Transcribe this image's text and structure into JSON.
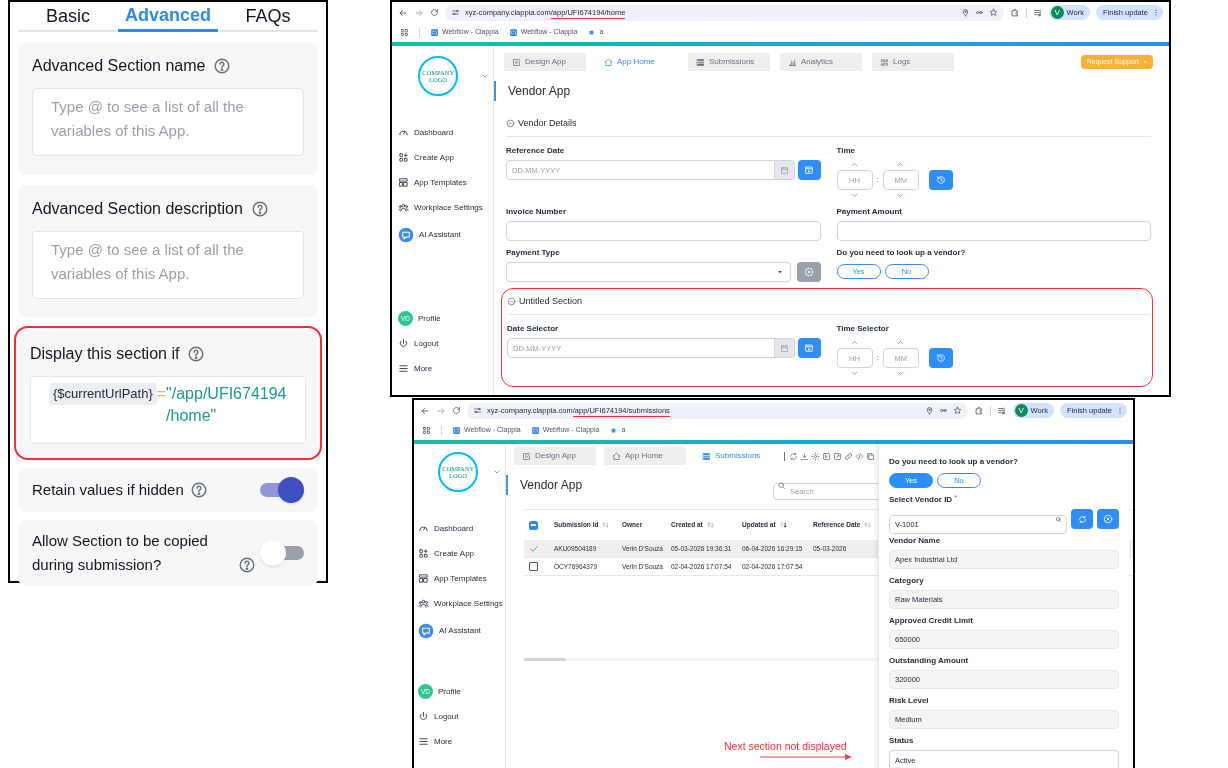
{
  "settings_panel": {
    "tabs": [
      {
        "label": "Basic",
        "selected": false
      },
      {
        "label": "Advanced",
        "selected": true
      },
      {
        "label": "FAQs",
        "selected": false
      }
    ],
    "text_fields": [
      {
        "label": "Advanced Section name",
        "placeholder": "Type @ to see a list of all the variables of this App."
      },
      {
        "label": "Advanced Section description",
        "placeholder": "Type @ to see a list of all the variables of this App."
      }
    ],
    "condition": {
      "label": "Display this section if",
      "variable": "{$currentUrlPath}",
      "operator": "=",
      "value": "\"/app/UFI674194/home\"",
      "highlighted": true
    },
    "toggles": [
      {
        "label": "Retain values if hidden",
        "on": true
      },
      {
        "label": "Allow Section to be copied during submission?",
        "on": false
      }
    ]
  },
  "home_window": {
    "browser": {
      "url_host": "xyz-company.clappia.com",
      "url_path": "/app/UFI674194/home",
      "path_underlined": true,
      "bookmarks": [
        "Webflow - Clappia",
        "Webflow - Clappia",
        "a"
      ],
      "profile_initial": "V",
      "profile_label": "Work",
      "update_label": "Finish update"
    },
    "sidebar": {
      "logo_text": "COMPANY LOGO",
      "items": [
        {
          "label": "Dashboard"
        },
        {
          "label": "Create App"
        },
        {
          "label": "App Templates"
        },
        {
          "label": "Workplace Settings"
        },
        {
          "label": "AI Assistant"
        }
      ],
      "bottom_items": [
        {
          "label": "Profile",
          "initials": "VD"
        },
        {
          "label": "Logout"
        },
        {
          "label": "More"
        }
      ]
    },
    "tabs": [
      {
        "label": "Design App",
        "selected": false
      },
      {
        "label": "App Home",
        "selected": true
      },
      {
        "label": "Submissions",
        "selected": false
      },
      {
        "label": "Analytics",
        "selected": false
      },
      {
        "label": "Logs",
        "selected": false
      }
    ],
    "support_button": "Request Support",
    "title": "Vendor App",
    "sections": [
      {
        "title": "Vendor Details",
        "highlighted": false,
        "fields": [
          {
            "kind": "date",
            "label": "Reference Date",
            "placeholder": "DD-MM-YYYY"
          },
          {
            "kind": "time",
            "label": "Time",
            "hour_placeholder": "HH",
            "minute_placeholder": "MM",
            "separator": ":"
          },
          {
            "kind": "text",
            "label": "Invoice Number"
          },
          {
            "kind": "text",
            "label": "Payment Amount"
          },
          {
            "kind": "dropdown",
            "label": "Payment Type"
          },
          {
            "kind": "choice",
            "label": "Do you need to look up a vendor?",
            "options": [
              {
                "label": "Yes",
                "selected": false
              },
              {
                "label": "No",
                "selected": false
              }
            ]
          }
        ]
      },
      {
        "title": "Untitled Section",
        "highlighted": true,
        "fields": [
          {
            "kind": "date",
            "label": "Date Selector",
            "placeholder": "DD-MM-YYYY"
          },
          {
            "kind": "time",
            "label": "Time Selector",
            "hour_placeholder": "HH",
            "minute_placeholder": "MM",
            "separator": ":"
          }
        ]
      }
    ]
  },
  "submissions_window": {
    "browser": {
      "url_host": "xyz-company.clappia.com",
      "url_path": "/app/UFI674194/submissions",
      "path_underlined": true,
      "bookmarks": [
        "Webflow - Clappia",
        "Webflow - Clappia",
        "a"
      ],
      "profile_initial": "V",
      "profile_label": "Work",
      "update_label": "Finish update"
    },
    "sidebar": {
      "logo_text": "COMPANY LOGO",
      "items": [
        {
          "label": "Dashboard"
        },
        {
          "label": "Create App"
        },
        {
          "label": "App Templates"
        },
        {
          "label": "Workplace Settings"
        },
        {
          "label": "AI Assistant"
        }
      ],
      "bottom_items": [
        {
          "label": "Profile",
          "initials": "VD"
        },
        {
          "label": "Logout"
        },
        {
          "label": "More"
        }
      ]
    },
    "tabs": [
      {
        "label": "Design App",
        "selected": false
      },
      {
        "label": "App Home",
        "selected": false
      },
      {
        "label": "Submissions",
        "selected": true
      }
    ],
    "title": "Vendor App",
    "search_placeholder": "Search",
    "table": {
      "header_checkbox_partial": true,
      "columns": [
        {
          "label": "Submission Id",
          "sortable": true,
          "sorted_descending": false
        },
        {
          "label": "Owner",
          "sortable": false
        },
        {
          "label": "Created at",
          "sortable": true,
          "sorted_descending": false
        },
        {
          "label": "Updated at",
          "sortable": true,
          "sorted_descending": true
        },
        {
          "label": "Reference Date",
          "sortable": true,
          "sorted_descending": false
        }
      ],
      "rows": [
        {
          "selected": true,
          "cells": [
            "AKU09504189",
            "Verin D'Souza",
            "05-03-2026 19:36:31",
            "06-04-2026 16:29:15",
            "05-03-2026"
          ]
        },
        {
          "selected": false,
          "cells": [
            "OCY76964379",
            "Verin D'Souza",
            "02-04-2026 17:07:54",
            "02-04-2026 17:07:54"
          ]
        }
      ]
    },
    "drawer": {
      "fields": [
        {
          "kind": "choice",
          "label": "Do you need to look up a vendor?",
          "options": [
            {
              "label": "Yes",
              "selected": true
            },
            {
              "label": "No",
              "selected": false
            }
          ]
        },
        {
          "kind": "lookup",
          "label": "Select Vendor ID",
          "required_mark": "*",
          "value": "V-1001"
        },
        {
          "kind": "text",
          "label": "Vendor Name",
          "value": "Apex Industrial Ltd",
          "readonly": true
        },
        {
          "kind": "text",
          "label": "Category",
          "value": "Raw Materials",
          "readonly": true
        },
        {
          "kind": "text",
          "label": "Approved Credit Limit",
          "value": "650000",
          "readonly": true
        },
        {
          "kind": "text",
          "label": "Outstanding Amount",
          "value": "320000",
          "readonly": true
        },
        {
          "kind": "text",
          "label": "Risk Level",
          "value": "Medium",
          "readonly": true
        },
        {
          "kind": "text",
          "label": "Status",
          "value": "Active",
          "readonly": false
        }
      ]
    }
  },
  "annotation": {
    "text": "Next section not displayed"
  }
}
